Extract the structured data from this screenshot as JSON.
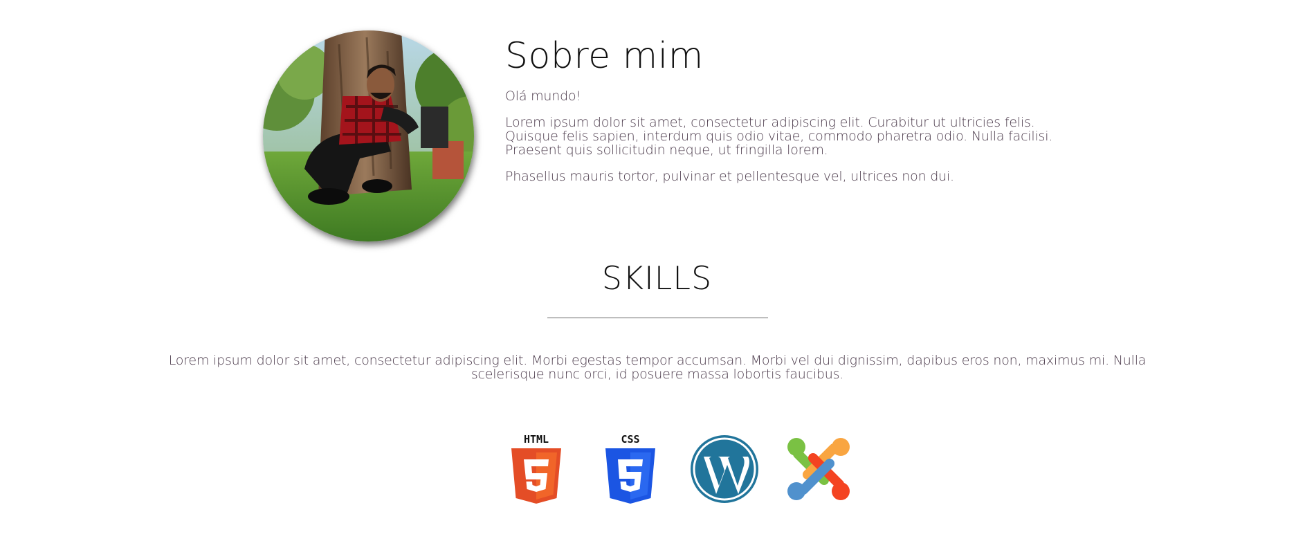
{
  "about": {
    "title": "Sobre mim",
    "greeting": "Olá mundo!",
    "paragraph1": [
      "Lorem ipsum dolor sit amet, consectetur adipiscing elit. Curabitur ut ultricies felis.",
      "Quisque felis sapien, interdum quis odio vitae, commodo pharetra odio. Nulla facilisi.",
      "Praesent quis sollicitudin neque, ut fringilla lorem."
    ],
    "paragraph2": "Phasellus mauris tortor, pulvinar et pellentesque vel, ultrices non dui."
  },
  "skills": {
    "title": "SKILLS",
    "description": "Lorem ipsum dolor sit amet, consectetur adipiscing elit. Morbi egestas tempor accumsan. Morbi vel dui dignissim, dapibus eros non, maximus mi. Nulla scelerisque nunc orci, id posuere massa lobortis faucibus.",
    "icons": [
      {
        "name": "html5-icon",
        "label": "HTML",
        "color": "#e44d26"
      },
      {
        "name": "css3-icon",
        "label": "CSS",
        "color": "#1572b6"
      },
      {
        "name": "wordpress-icon",
        "color": "#21759b"
      },
      {
        "name": "joomla-icon",
        "colors": [
          "#7ac143",
          "#f9a541",
          "#f44321",
          "#5091cd"
        ]
      }
    ]
  },
  "colors": {
    "heading": "#111111",
    "body_text": "#4b3a4b",
    "divider": "#666666"
  }
}
